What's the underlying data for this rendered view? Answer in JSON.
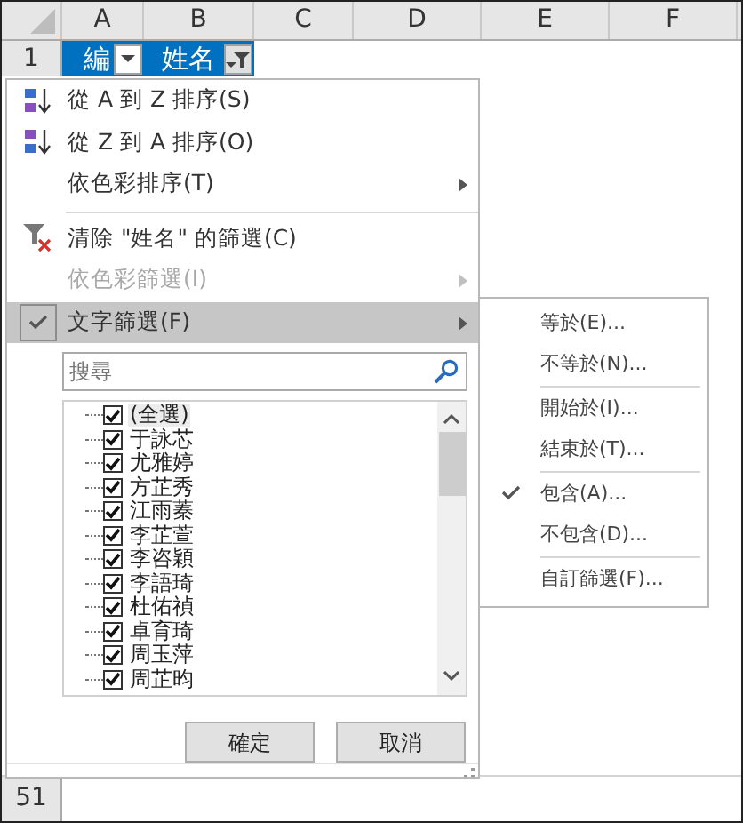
{
  "sheet": {
    "columns": [
      "A",
      "B",
      "C",
      "D",
      "E",
      "F"
    ],
    "rows": [
      {
        "header": "1",
        "cells": [
          {
            "text": "編",
            "kind": "dropdown",
            "selected": true
          },
          {
            "text": "姓名",
            "kind": "filtered",
            "selected": true
          }
        ]
      },
      {
        "header": "51",
        "cells": []
      }
    ]
  },
  "menu": {
    "items": [
      {
        "kind": "ascending",
        "label": "從 A 到 Z 排序(S)",
        "disabled": false,
        "submenu": false,
        "highlighted": false,
        "checked": false
      },
      {
        "kind": "descending",
        "label": "從 Z 到 A 排序(O)",
        "disabled": false,
        "submenu": false,
        "highlighted": false,
        "checked": false
      },
      {
        "kind": "item",
        "label": "依色彩排序(T)",
        "disabled": false,
        "submenu": true,
        "highlighted": false,
        "checked": false
      },
      {
        "kind": "separator"
      },
      {
        "kind": "clear",
        "label": "清除 \"姓名\" 的篩選(C)",
        "disabled": false,
        "submenu": false,
        "highlighted": false,
        "checked": false
      },
      {
        "kind": "item",
        "label": "依色彩篩選(I)",
        "disabled": true,
        "submenu": true,
        "highlighted": false,
        "checked": false
      },
      {
        "kind": "item",
        "label": "文字篩選(F)",
        "disabled": false,
        "submenu": true,
        "highlighted": true,
        "checked": true
      }
    ],
    "search": {
      "placeholder": "搜尋"
    },
    "values": [
      {
        "label": "(全選)",
        "checked": true,
        "focused": true
      },
      {
        "label": "于詠芯",
        "checked": true,
        "focused": false
      },
      {
        "label": "尤雅婷",
        "checked": true,
        "focused": false
      },
      {
        "label": "方芷秀",
        "checked": true,
        "focused": false
      },
      {
        "label": "江雨蓁",
        "checked": true,
        "focused": false
      },
      {
        "label": "李芷萱",
        "checked": true,
        "focused": false
      },
      {
        "label": "李咨穎",
        "checked": true,
        "focused": false
      },
      {
        "label": "李語琦",
        "checked": true,
        "focused": false
      },
      {
        "label": "杜佑禎",
        "checked": true,
        "focused": false
      },
      {
        "label": "卓育琦",
        "checked": true,
        "focused": false
      },
      {
        "label": "周玉萍",
        "checked": true,
        "focused": false
      },
      {
        "label": "周芷昀",
        "checked": true,
        "focused": false
      }
    ],
    "buttons": [
      "確定",
      "取消"
    ]
  },
  "submenu": {
    "items": [
      {
        "kind": "item",
        "label": "等於(E)...",
        "checked": false
      },
      {
        "kind": "item",
        "label": "不等於(N)...",
        "checked": false
      },
      {
        "kind": "separator"
      },
      {
        "kind": "item",
        "label": "開始於(I)...",
        "checked": false
      },
      {
        "kind": "item",
        "label": "結束於(T)...",
        "checked": false
      },
      {
        "kind": "separator"
      },
      {
        "kind": "item",
        "label": "包含(A)...",
        "checked": true
      },
      {
        "kind": "item",
        "label": "不包含(D)...",
        "checked": false
      },
      {
        "kind": "separator"
      },
      {
        "kind": "item",
        "label": "自訂篩選(F)...",
        "checked": false
      }
    ]
  }
}
